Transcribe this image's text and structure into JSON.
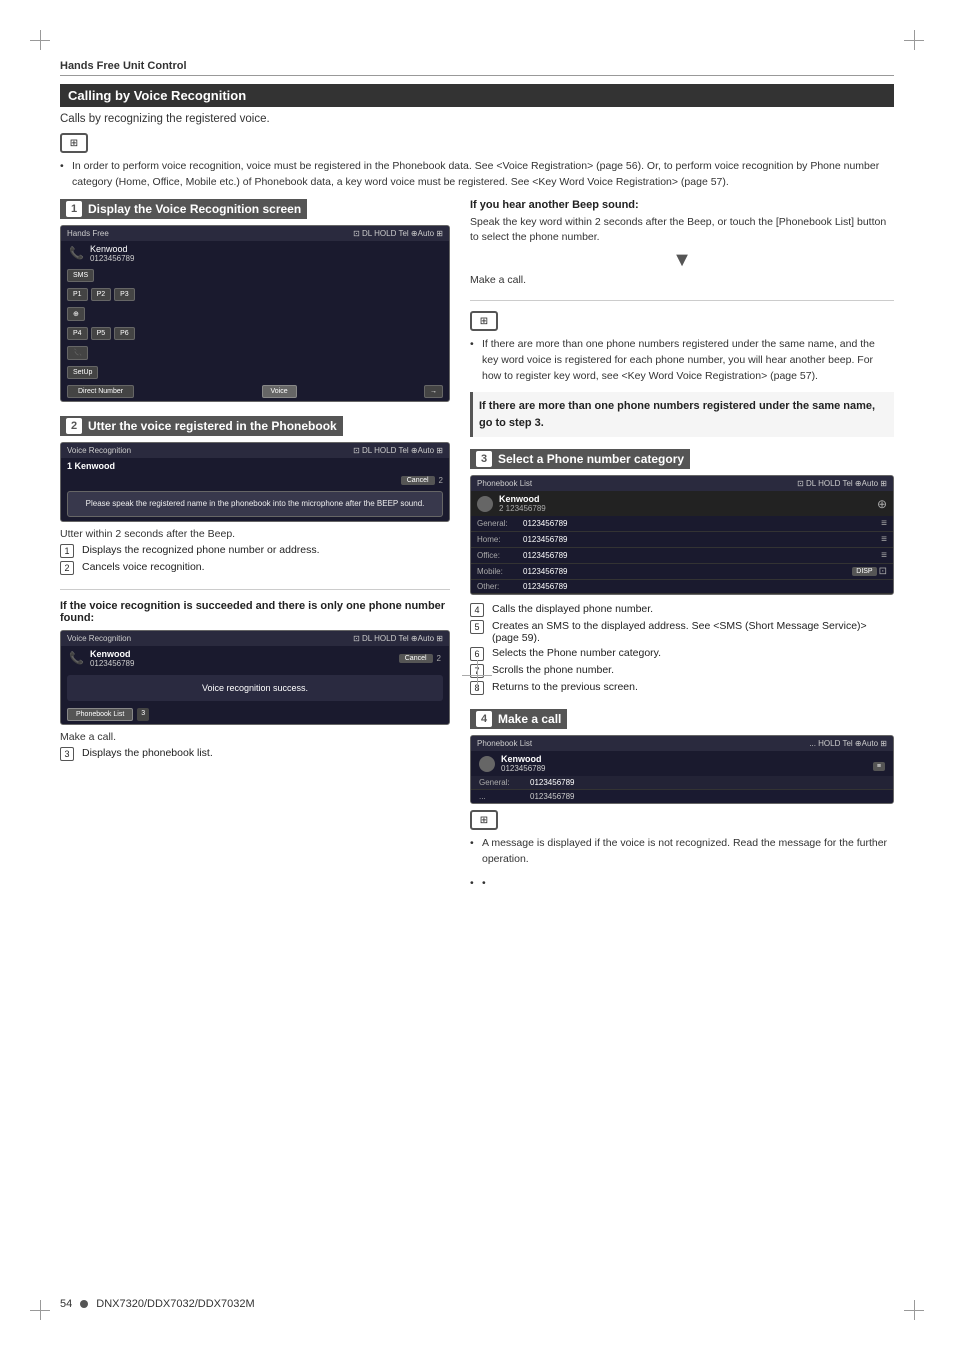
{
  "page": {
    "title": "Hands Free Unit Control",
    "footer": "54",
    "footer_model": "DNX7320/DDX7032/DDX7032M"
  },
  "section": {
    "title": "Calling by Voice Recognition",
    "subtitle": "Calls by recognizing the registered voice."
  },
  "icon_box": "⊞",
  "bullet1": "In order to perform voice recognition, voice must be registered in the Phonebook data. See <Voice Registration> (page 56). Or, to perform voice recognition by Phone number category (Home, Office, Mobile etc.) of Phonebook data, a key word voice must be registered. See <Key Word Voice Registration> (page 57).",
  "steps": {
    "step1": {
      "num": "1",
      "label": "Display the Voice Recognition screen",
      "screen": {
        "title": "Hands Free",
        "status_icons": "⊡ DL HOLD Tel ⊕Auto ⊞",
        "name": "Kenwood",
        "number": "0123456789",
        "buttons": [
          "P1",
          "P2",
          "P3",
          "P4",
          "P5",
          "P6"
        ],
        "setup_btn": "SetUp",
        "direct_btn": "Direct Number",
        "voice_btn": "Voice"
      }
    },
    "step2": {
      "num": "2",
      "label": "Utter the voice registered in the Phonebook",
      "screen": {
        "title": "Voice Recognition",
        "status_icons": "⊡ DL HOLD Tel ⊕Auto ⊞",
        "name": "1 Kenwood",
        "cancel_btn": "Cancel",
        "dialog": "Please speak the registered name\nin the phonebook into the microphone\nafter the BEEP sound.",
        "num2_label": "2"
      },
      "caption": "Utter within 2 seconds after the Beep.",
      "notes": [
        {
          "num": "1",
          "text": "Displays the recognized phone number or address."
        },
        {
          "num": "2",
          "text": "Cancels voice recognition."
        }
      ]
    },
    "if_success": {
      "title": "If the voice recognition is succeeded and there is only one phone number found:",
      "screen": {
        "title": "Voice Recognition",
        "status_icons": "⊡ DL HOLD Tel ⊕Auto ⊞",
        "name": "Kenwood",
        "number": "0123456789",
        "cancel_btn": "Cancel",
        "num2_label": "2",
        "msg": "Voice recognition success.",
        "phonebook_btn": "Phonebook List",
        "num3_label": "3"
      },
      "caption1": "Make a call.",
      "note3": "3",
      "note3_text": "Displays the phonebook list."
    },
    "if_beep": {
      "title": "If you hear another Beep sound:",
      "text": "Speak the key word within 2 seconds after the Beep, or touch the [Phonebook List] button to select the phone number.",
      "caption2": "Make a call."
    },
    "bullet2": "If there are more than one phone numbers registered under the same name, and the key word voice is registered for each phone number, you will hear another beep. For how to register key word, see <Key Word Voice Registration> (page 57).",
    "if_more": {
      "title": "If there are more than one phone numbers registered under the same name, go to step 3."
    },
    "step3": {
      "num": "3",
      "label": "Select a Phone number category",
      "screen": {
        "title": "Phonebook List",
        "status_icons": "⊡ DL HOLD Tel ⊕Auto ⊞",
        "name": "Kenwood",
        "number_top": "2 123456789",
        "rows": [
          {
            "label": "General:",
            "num": "0123456789"
          },
          {
            "label": "Home:",
            "num": "0123456789"
          },
          {
            "label": "Office:",
            "num": "0123456789"
          },
          {
            "label": "Mobile:",
            "num": "0123456789",
            "btn": "DISP"
          },
          {
            "label": "Other:",
            "num": "0123456789"
          }
        ]
      },
      "notes": [
        {
          "num": "4",
          "text": "Calls the displayed phone number."
        },
        {
          "num": "5",
          "text": "Creates an SMS to the displayed address. See <SMS (Short Message Service)> (page 59)."
        },
        {
          "num": "6",
          "text": "Selects the Phone number category."
        },
        {
          "num": "7",
          "text": "Scrolls the phone number."
        },
        {
          "num": "8",
          "text": "Returns to the previous screen."
        }
      ]
    },
    "step4": {
      "num": "4",
      "label": "Make a call",
      "screen": {
        "title": "Phonebook List",
        "status_icons": "... HOLD Tel ⊕Auto ⊞",
        "name": "Kenwood",
        "number": "0123456789",
        "gen_label": "General:",
        "gen_num": "0123456789",
        "next_label": "...",
        "next_num": "0123456789"
      }
    },
    "final_notes": [
      "A message is displayed if the voice is not recognized. Read the message for the further operation.",
      ""
    ]
  }
}
